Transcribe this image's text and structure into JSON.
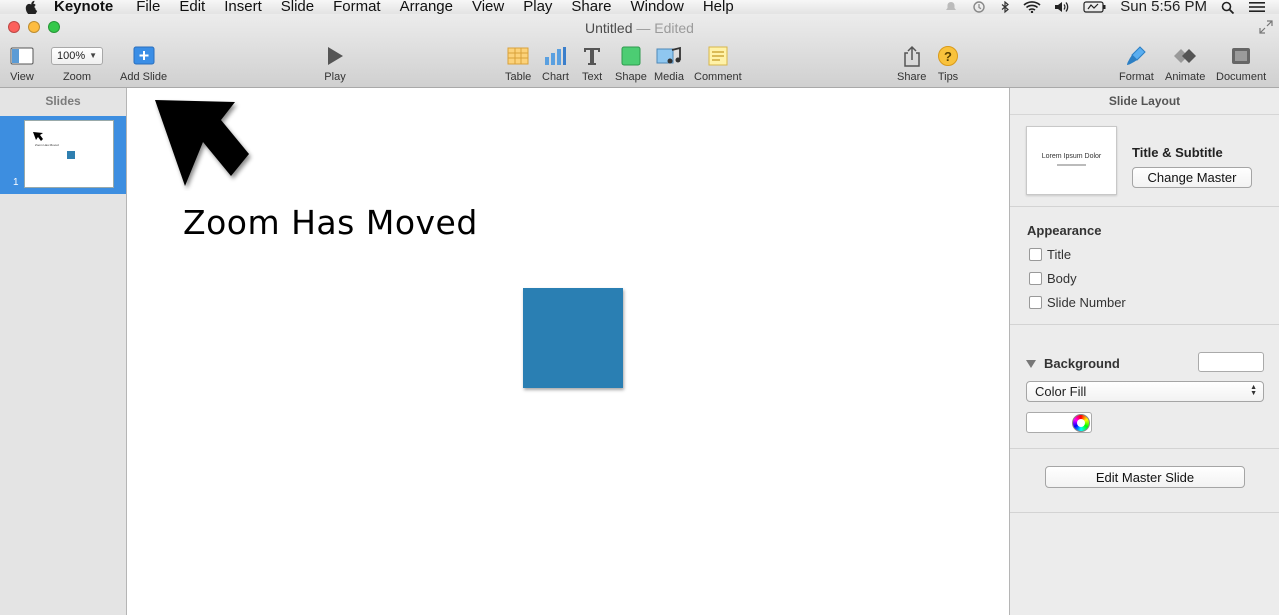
{
  "menubar": {
    "apple_icon": "apple-icon",
    "app_name": "Keynote",
    "items": [
      "File",
      "Edit",
      "Insert",
      "Slide",
      "Format",
      "Arrange",
      "View",
      "Play",
      "Share",
      "Window",
      "Help"
    ],
    "clock": "Sun 5:56 PM",
    "status_icons": [
      "notification-icon",
      "time-machine-icon",
      "bluetooth-icon",
      "wifi-icon",
      "volume-icon",
      "battery-icon",
      "search-icon",
      "menu-list-icon"
    ]
  },
  "window": {
    "title": "Untitled",
    "separator": " — ",
    "status": "Edited"
  },
  "toolbar": {
    "view": "View",
    "zoom_label": "Zoom",
    "zoom_value": "100%",
    "add_slide": "Add Slide",
    "play": "Play",
    "table": "Table",
    "chart": "Chart",
    "text": "Text",
    "shape": "Shape",
    "media": "Media",
    "comment": "Comment",
    "share": "Share",
    "tips": "Tips",
    "format": "Format",
    "animate": "Animate",
    "document": "Document"
  },
  "navigator": {
    "title": "Slides",
    "slide_number": "1"
  },
  "slide": {
    "heading": "Zoom Has Moved",
    "colors": {
      "square": "#2a7fb3"
    }
  },
  "inspector": {
    "title": "Slide Layout",
    "master_preview_title": "Lorem Ipsum Dolor",
    "master_name": "Title & Subtitle",
    "change_master": "Change Master",
    "appearance_label": "Appearance",
    "appearance_options": [
      "Title",
      "Body",
      "Slide Number"
    ],
    "background_label": "Background",
    "fill_type": "Color Fill",
    "edit_master": "Edit Master Slide"
  }
}
